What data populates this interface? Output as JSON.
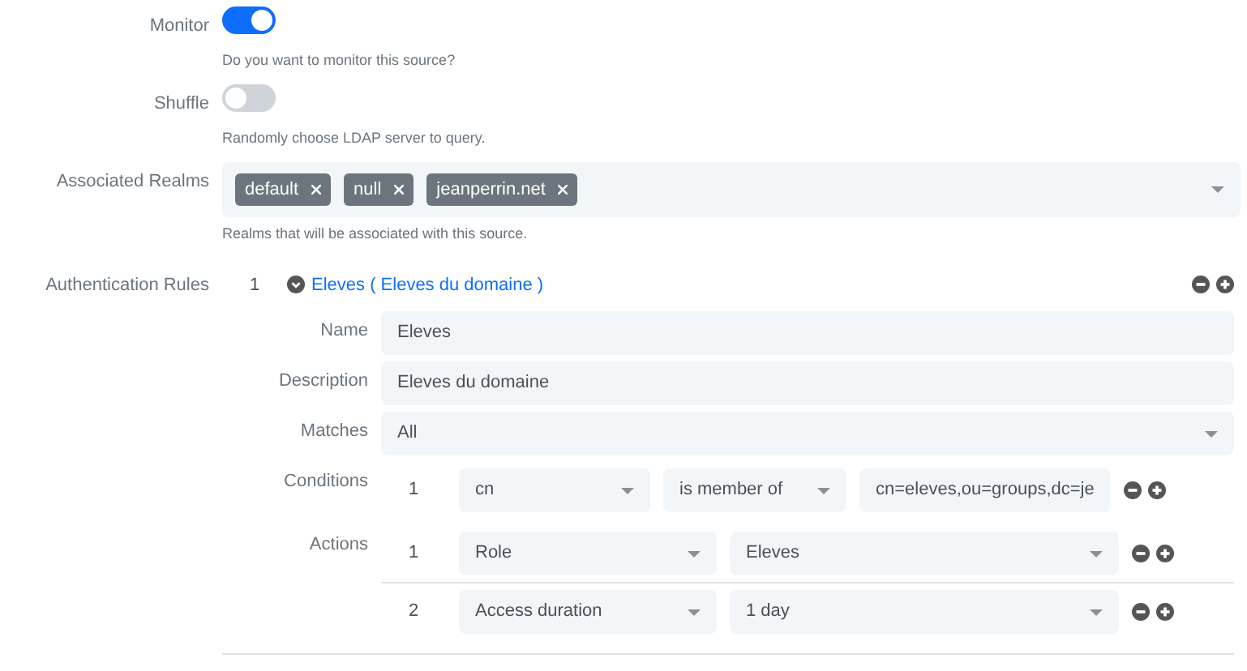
{
  "fields": [
    {
      "kind": "toggle",
      "label": "Monitor",
      "on": true,
      "help": "Do you want to monitor this source?"
    },
    {
      "kind": "toggle",
      "label": "Shuffle",
      "on": false,
      "help": "Randomly choose LDAP server to query."
    },
    {
      "kind": "tags",
      "label": "Associated Realms",
      "tags": [
        "default",
        "null",
        "jeanperrin.net"
      ],
      "help": "Realms that will be associated with this source."
    }
  ],
  "authentication_rules": {
    "label": "Authentication Rules",
    "rules": [
      {
        "number": "1",
        "expanded": true,
        "title": "Eleves ( Eleves du domaine )",
        "name_label": "Name",
        "name": "Eleves",
        "description_label": "Description",
        "description": "Eleves du domaine",
        "matches_label": "Matches",
        "matches": "All",
        "conditions_label": "Conditions",
        "conditions": [
          {
            "number": "1",
            "attribute": "cn",
            "operator": "is member of",
            "value": "cn=eleves,ou=groups,dc=je"
          }
        ],
        "actions_label": "Actions",
        "actions": [
          {
            "number": "1",
            "type": "Role",
            "value": "Eleves"
          },
          {
            "number": "2",
            "type": "Access duration",
            "value": "1 day"
          }
        ]
      }
    ]
  }
}
